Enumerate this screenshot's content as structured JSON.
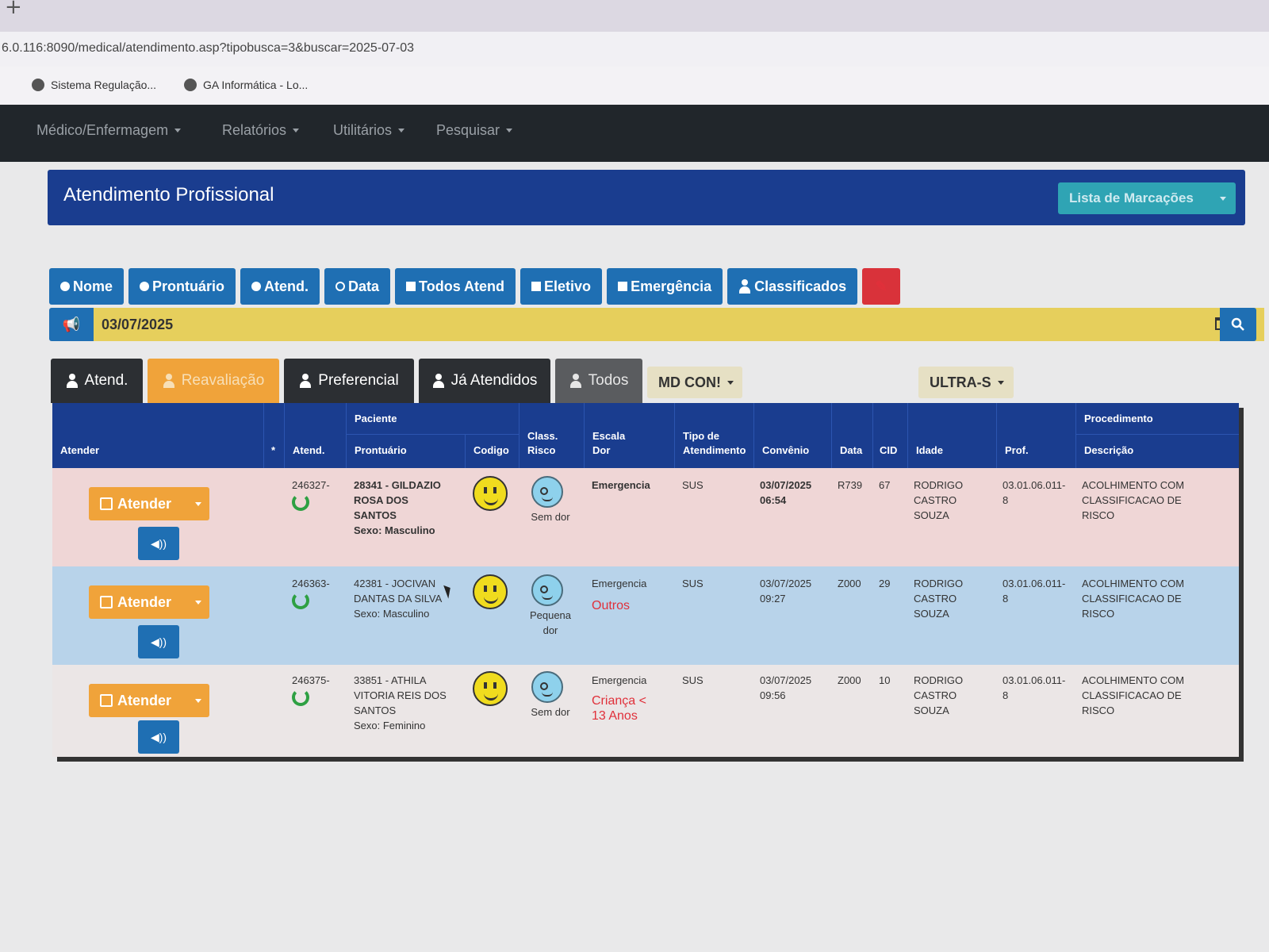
{
  "browser": {
    "url": "6.0.116:8090/medical/atendimento.asp?tipobusca=3&buscar=2025-07-03",
    "bookmarks": [
      "Sistema Regulação...",
      "GA Informática - Lo..."
    ]
  },
  "nav": {
    "items": [
      "Médico/Enfermagem",
      "Relatórios",
      "Utilitários",
      "Pesquisar"
    ]
  },
  "header": {
    "title": "Atendimento Profissional",
    "lista_button": "Lista de Marcações"
  },
  "filters": {
    "nome": "Nome",
    "prontuario": "Prontuário",
    "atend": "Atend.",
    "data": "Data",
    "todos_atend": "Todos Atend",
    "eletivo": "Eletivo",
    "emergencia": "Emergência",
    "classificados": "Classificados"
  },
  "search": {
    "date_value": "03/07/2025"
  },
  "tabs": {
    "atend": "Atend.",
    "reavaliacao": "Reavaliação",
    "preferencial": "Preferencial",
    "ja_atendidos": "Já Atendidos",
    "todos": "Todos",
    "select1": "MD CON!",
    "select2": "ULTRA-S"
  },
  "colors": {
    "primary": "#1f6fb3",
    "header": "#1a3d8f",
    "warning": "#f0a33a",
    "danger": "#d9323a",
    "info": "#2fa4b4",
    "dark": "#2c2f33",
    "date_bg": "#e6cf5c"
  },
  "table": {
    "headers": {
      "atender": "Atender",
      "star": "*",
      "atend": "Atend.",
      "paciente": "Paciente",
      "prontuario": "Prontuário",
      "codigo": "Codigo",
      "class_risco_1": "Class.",
      "class_risco_2": "Risco",
      "escala_dor_1": "Escala",
      "escala_dor_2": "Dor",
      "tipo_1": "Tipo de",
      "tipo_2": "Atendimento",
      "convenio": "Convênio",
      "data": "Data",
      "cid": "CID",
      "idade": "Idade",
      "prof": "Prof.",
      "procedimento": "Procedimento",
      "descricao": "Descrição"
    },
    "atender_label": "Atender",
    "rows": [
      {
        "atend": "246327-",
        "paciente_1": "28341 - GILDAZIO",
        "paciente_2": "ROSA DOS",
        "paciente_3": "SANTOS",
        "sexo": "Sexo: Masculino",
        "dor": "Sem dor",
        "tipo": "Emergencia",
        "tipo_extra_1": "",
        "tipo_extra_2": "",
        "convenio": "SUS",
        "data_1": "03/07/2025",
        "data_2": "06:54",
        "data_col": "R739",
        "cid": "67",
        "idade_1": "RODRIGO",
        "idade_2": "CASTRO",
        "idade_3": "SOUZA",
        "prof_1": "03.01.06.011-",
        "prof_2": "8",
        "desc_1": "ACOLHIMENTO COM",
        "desc_2": "CLASSIFICACAO DE",
        "desc_3": "RISCO"
      },
      {
        "atend": "246363-",
        "paciente_1": "42381 - JOCIVAN",
        "paciente_2": "DANTAS DA SILVA",
        "paciente_3": "",
        "sexo": "Sexo: Masculino",
        "dor": "Pequena dor",
        "tipo": "Emergencia",
        "tipo_extra_1": "Outros",
        "tipo_extra_2": "",
        "convenio": "SUS",
        "data_1": "03/07/2025",
        "data_2": "09:27",
        "data_col": "Z000",
        "cid": "29",
        "idade_1": "RODRIGO",
        "idade_2": "CASTRO",
        "idade_3": "SOUZA",
        "prof_1": "03.01.06.011-",
        "prof_2": "8",
        "desc_1": "ACOLHIMENTO COM",
        "desc_2": "CLASSIFICACAO DE",
        "desc_3": "RISCO"
      },
      {
        "atend": "246375-",
        "paciente_1": "33851 - ATHILA",
        "paciente_2": "VITORIA REIS DOS",
        "paciente_3": "SANTOS",
        "sexo": "Sexo: Feminino",
        "dor": "Sem dor",
        "tipo": "Emergencia",
        "tipo_extra_1": "Criança <",
        "tipo_extra_2": "13 Anos",
        "convenio": "SUS",
        "data_1": "03/07/2025",
        "data_2": "09:56",
        "data_col": "Z000",
        "cid": "10",
        "idade_1": "RODRIGO",
        "idade_2": "CASTRO",
        "idade_3": "SOUZA",
        "prof_1": "03.01.06.011-",
        "prof_2": "8",
        "desc_1": "ACOLHIMENTO COM",
        "desc_2": "CLASSIFICACAO DE",
        "desc_3": "RISCO"
      }
    ]
  }
}
